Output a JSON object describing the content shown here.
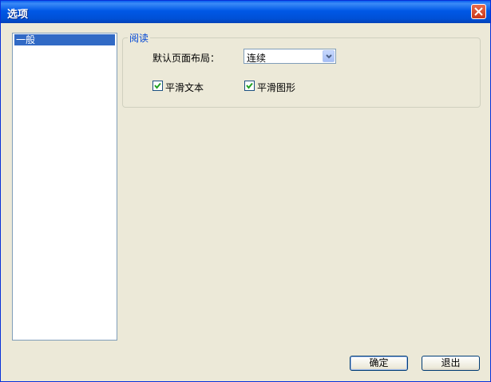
{
  "window": {
    "title": "选项"
  },
  "nav": {
    "items": [
      {
        "label": "一般",
        "selected": true
      }
    ]
  },
  "group": {
    "title": "阅读",
    "layout_label": "默认页面布局：",
    "layout_value": "连续",
    "smooth_text": {
      "label": "平滑文本",
      "checked": true
    },
    "smooth_graphics": {
      "label": "平滑图形",
      "checked": true
    }
  },
  "buttons": {
    "ok": "确定",
    "exit": "退出"
  },
  "icons": {
    "close": "close-icon",
    "dropdown": "chevron-down-icon",
    "check": "check-icon"
  },
  "colors": {
    "titlebar": "#0058e6",
    "selection": "#316ac5",
    "legend": "#0046d5",
    "face": "#ece9d8"
  }
}
